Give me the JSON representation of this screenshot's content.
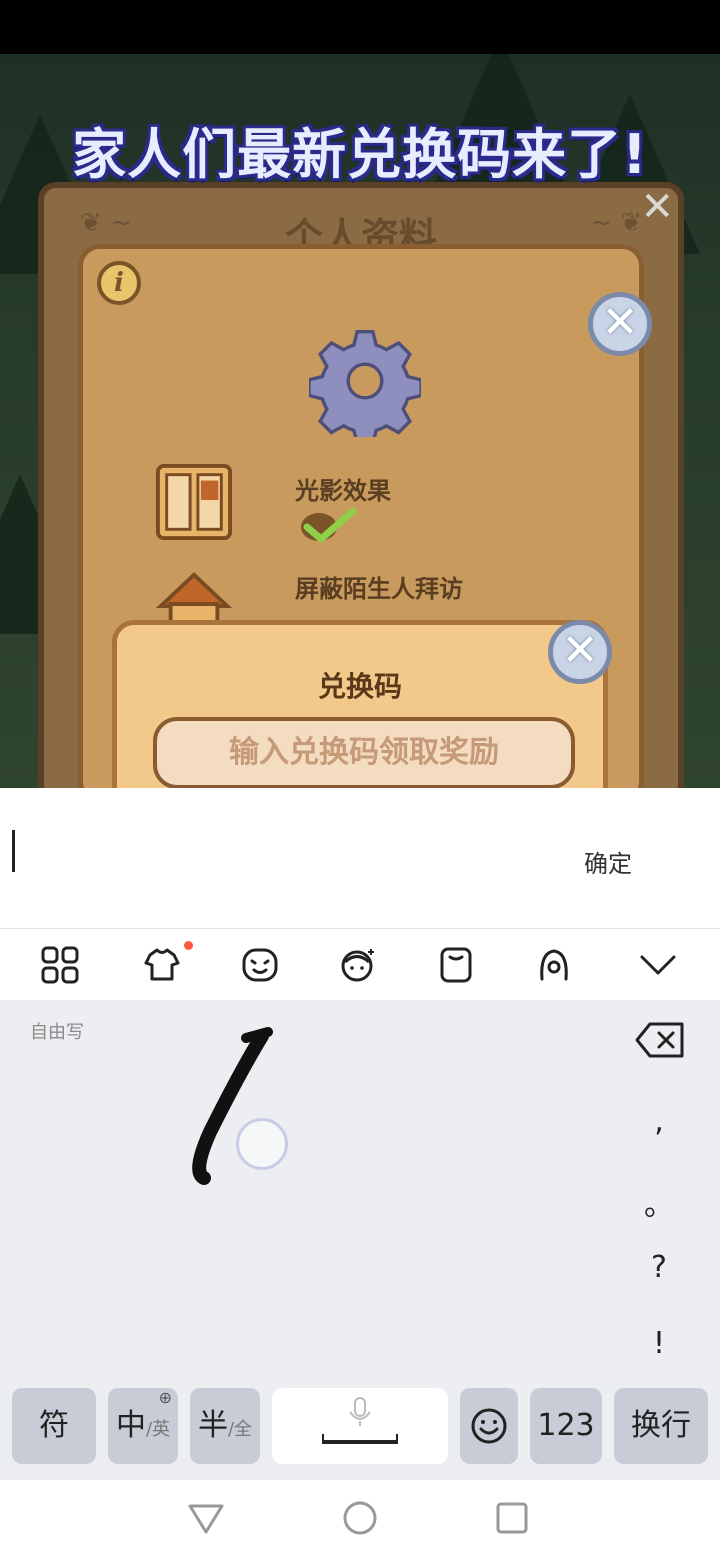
{
  "overlay": {
    "caption": "家人们最新兑换码来了!"
  },
  "game": {
    "back_panel_title": "个人资料",
    "settings": [
      {
        "label": "光影效果",
        "enabled": true
      },
      {
        "label": "屏蔽陌生人拜访",
        "enabled": false
      }
    ],
    "redeem_dialog": {
      "title": "兑换码",
      "input_placeholder": "输入兑换码领取奖励"
    }
  },
  "ime": {
    "input_value": "",
    "confirm_label": "确定",
    "toolbar_icons": [
      "grid-icon",
      "skin-icon",
      "sticker-icon",
      "avatar-icon",
      "clipboard-icon",
      "handwriting-mode-icon",
      "collapse-chevron-icon"
    ],
    "handwriting_label": "自由写",
    "side_keys": [
      ",",
      "。",
      "?",
      "!"
    ],
    "bottom_keys": {
      "symbols": "符",
      "lang_main": "中",
      "lang_alt": "/英",
      "width_main": "半",
      "width_alt": "/全",
      "numbers": "123",
      "enter": "换行"
    }
  },
  "colors": {
    "caption_fill": "#e8ecff",
    "caption_outline": "#2a2a8a",
    "panel": "#c89a5e",
    "dialog": "#f2c98a",
    "keyboard_bg": "#eceef2",
    "key_grey": "#c7ccd6",
    "notification_dot": "#ff5a3c"
  }
}
